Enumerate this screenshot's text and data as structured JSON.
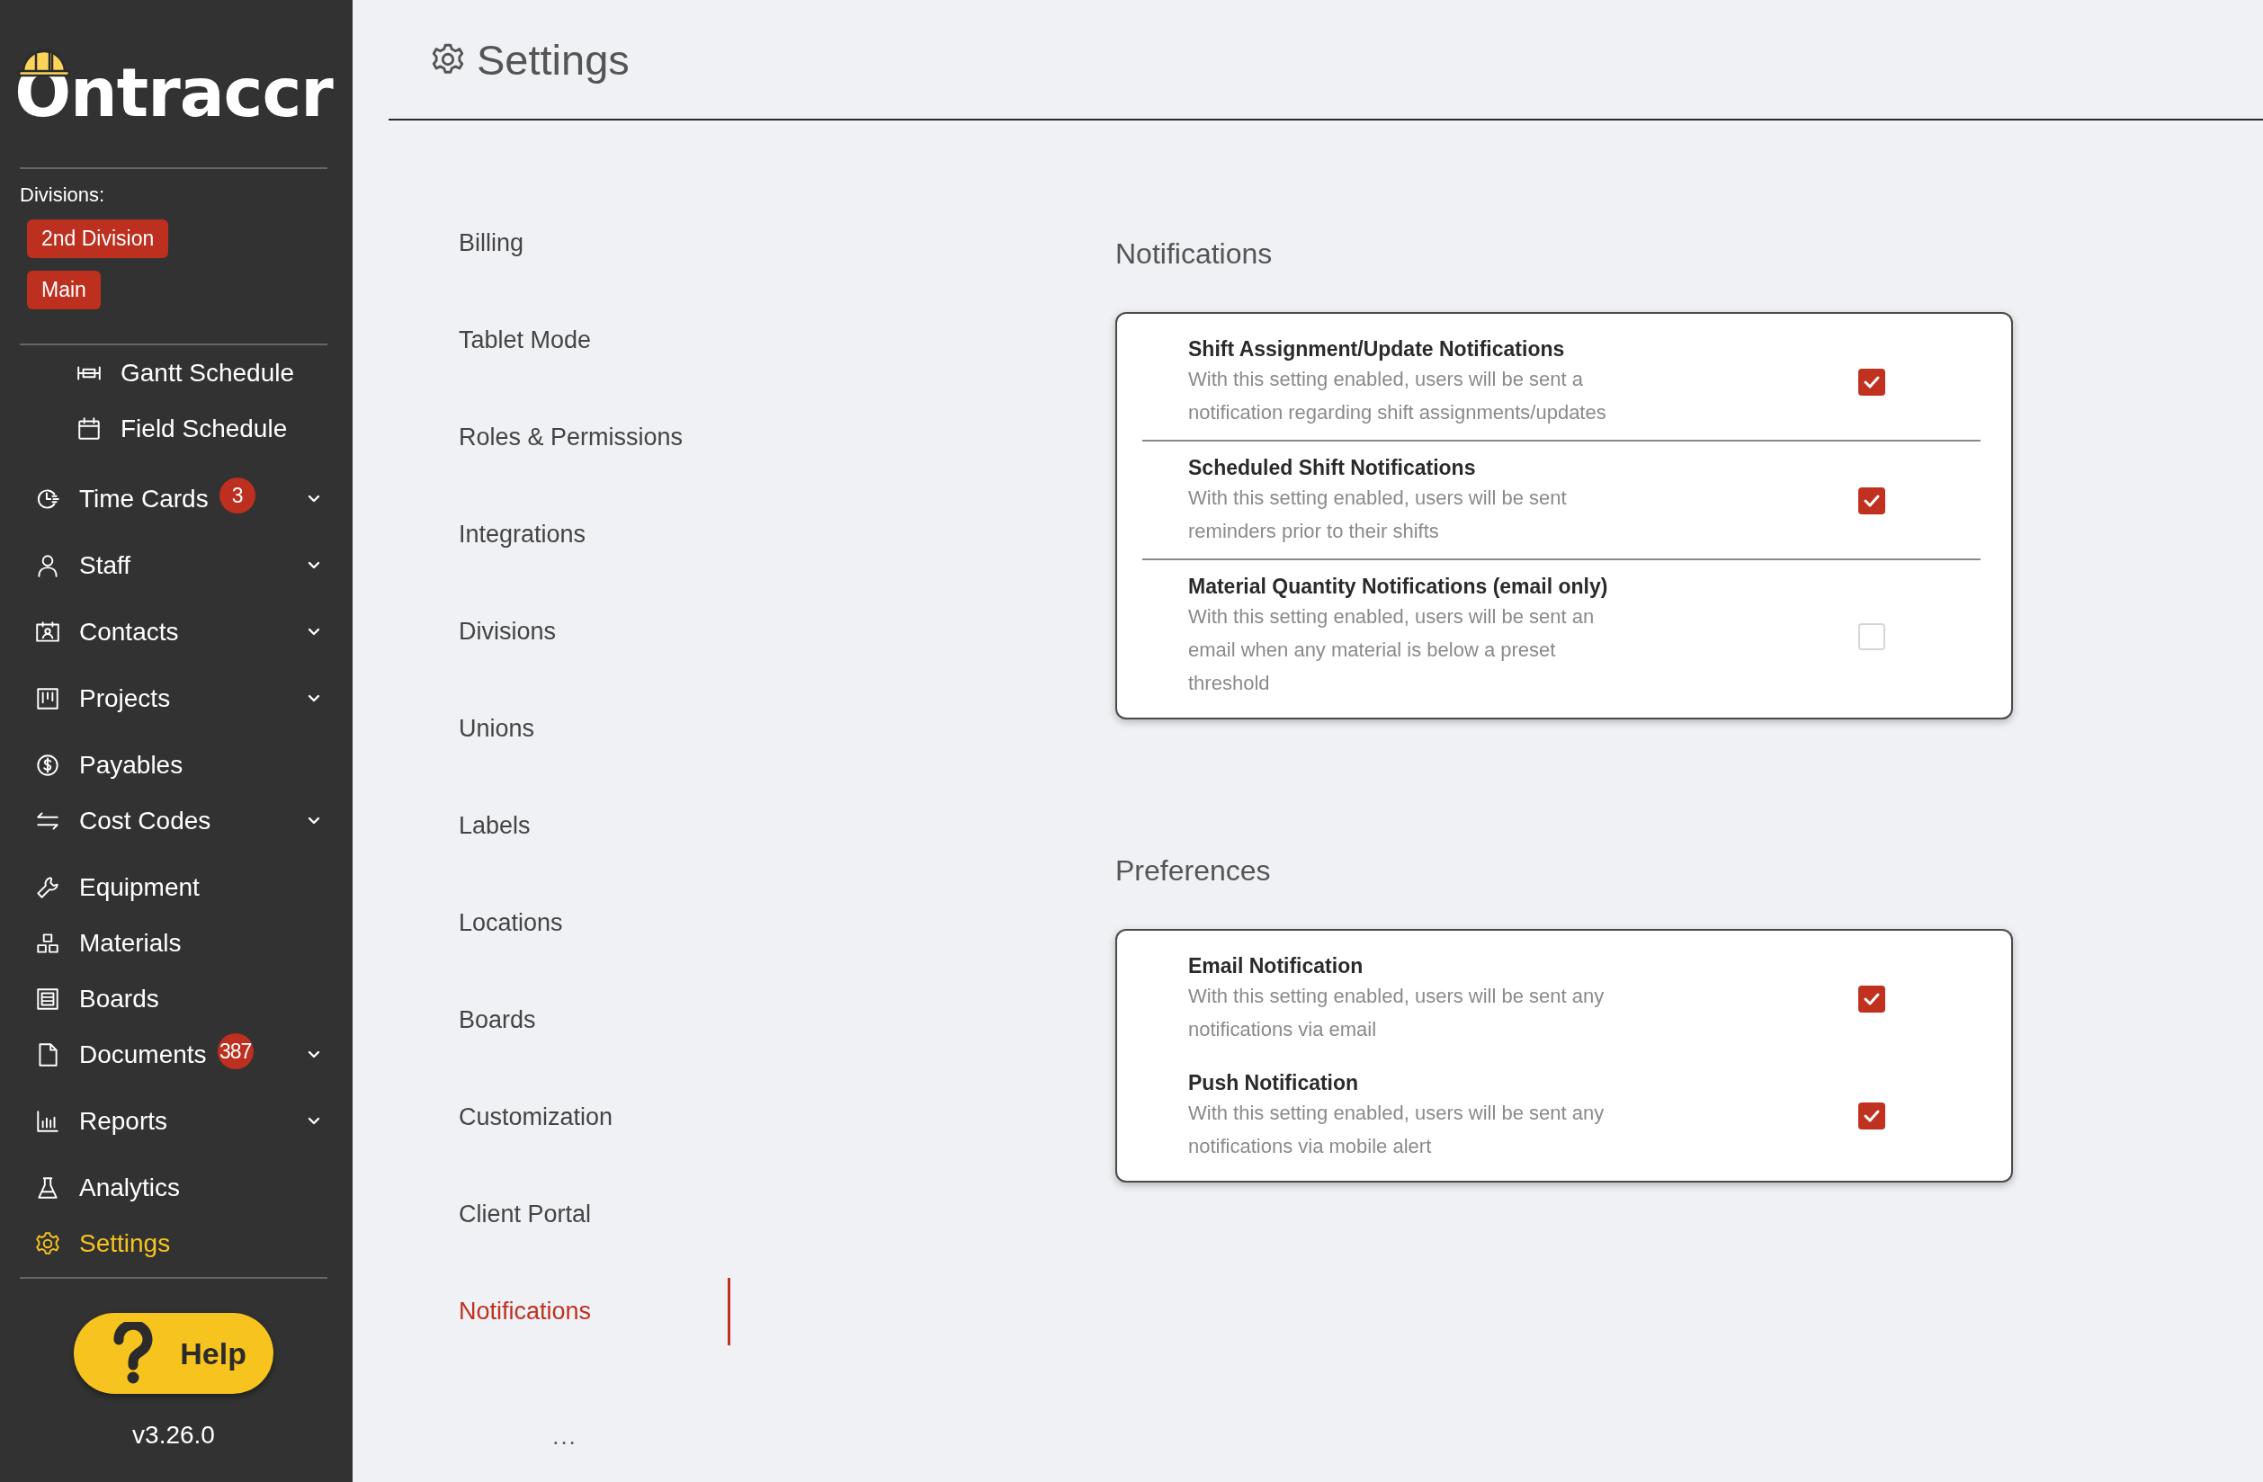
{
  "sidebar": {
    "logo": "Ontraccr",
    "divisions_label": "Divisions:",
    "divisions": [
      {
        "label": "2nd Division"
      },
      {
        "label": "Main"
      }
    ],
    "nav": [
      {
        "label": "Gantt Schedule",
        "kind": "subitem",
        "expandable": false,
        "selected": false
      },
      {
        "label": "Field Schedule",
        "kind": "subitem",
        "expandable": false,
        "selected": false
      },
      {
        "label": "Time Cards",
        "kind": "item",
        "badge": "3",
        "expandable": true,
        "selected": false
      },
      {
        "label": "Staff",
        "kind": "item",
        "expandable": true,
        "selected": false
      },
      {
        "label": "Contacts",
        "kind": "item",
        "expandable": true,
        "selected": false
      },
      {
        "label": "Projects",
        "kind": "item",
        "expandable": true,
        "selected": false
      },
      {
        "label": "Payables",
        "kind": "item",
        "expandable": false,
        "selected": false
      },
      {
        "label": "Cost Codes",
        "kind": "item",
        "expandable": true,
        "selected": false
      },
      {
        "label": "Equipment",
        "kind": "item",
        "expandable": false,
        "selected": false
      },
      {
        "label": "Materials",
        "kind": "item",
        "expandable": false,
        "selected": false
      },
      {
        "label": "Boards",
        "kind": "item",
        "expandable": false,
        "selected": false
      },
      {
        "label": "Documents",
        "kind": "item",
        "badge": "387",
        "expandable": true,
        "selected": false
      },
      {
        "label": "Reports",
        "kind": "item",
        "expandable": true,
        "selected": false
      },
      {
        "label": "Analytics",
        "kind": "item",
        "expandable": false,
        "selected": false
      },
      {
        "label": "Settings",
        "kind": "item",
        "expandable": false,
        "selected": true
      }
    ],
    "help_button": "Help",
    "version": "v3.26.0"
  },
  "page": {
    "title": "Settings"
  },
  "settings_menu": {
    "items": [
      {
        "label": "Billing",
        "selected": false
      },
      {
        "label": "Tablet Mode",
        "selected": false
      },
      {
        "label": "Roles & Permissions",
        "selected": false
      },
      {
        "label": "Integrations",
        "selected": false
      },
      {
        "label": "Divisions",
        "selected": false
      },
      {
        "label": "Unions",
        "selected": false
      },
      {
        "label": "Labels",
        "selected": false
      },
      {
        "label": "Locations",
        "selected": false
      },
      {
        "label": "Boards",
        "selected": false
      },
      {
        "label": "Customization",
        "selected": false
      },
      {
        "label": "Client Portal",
        "selected": false
      },
      {
        "label": "Notifications",
        "selected": true
      }
    ],
    "more_indicator": "..."
  },
  "sections": [
    {
      "title": "Notifications",
      "divided": true,
      "settings": [
        {
          "title": "Shift Assignment/Update Notifications",
          "description": "With this setting enabled, users will be sent a notification regarding shift assignments/updates",
          "checked": true
        },
        {
          "title": "Scheduled Shift Notifications",
          "description": "With this setting enabled, users will be sent reminders prior to their shifts",
          "checked": true
        },
        {
          "title": "Material Quantity Notifications (email only)",
          "description": "With this setting enabled, users will be sent an email when any material is below a preset threshold",
          "checked": false
        }
      ]
    },
    {
      "title": "Preferences",
      "divided": false,
      "settings": [
        {
          "title": "Email Notification",
          "description": "With this setting enabled, users will be sent any notifications via email",
          "checked": true
        },
        {
          "title": "Push Notification",
          "description": "With this setting enabled, users will be sent any notifications via mobile alert",
          "checked": true
        }
      ]
    }
  ]
}
